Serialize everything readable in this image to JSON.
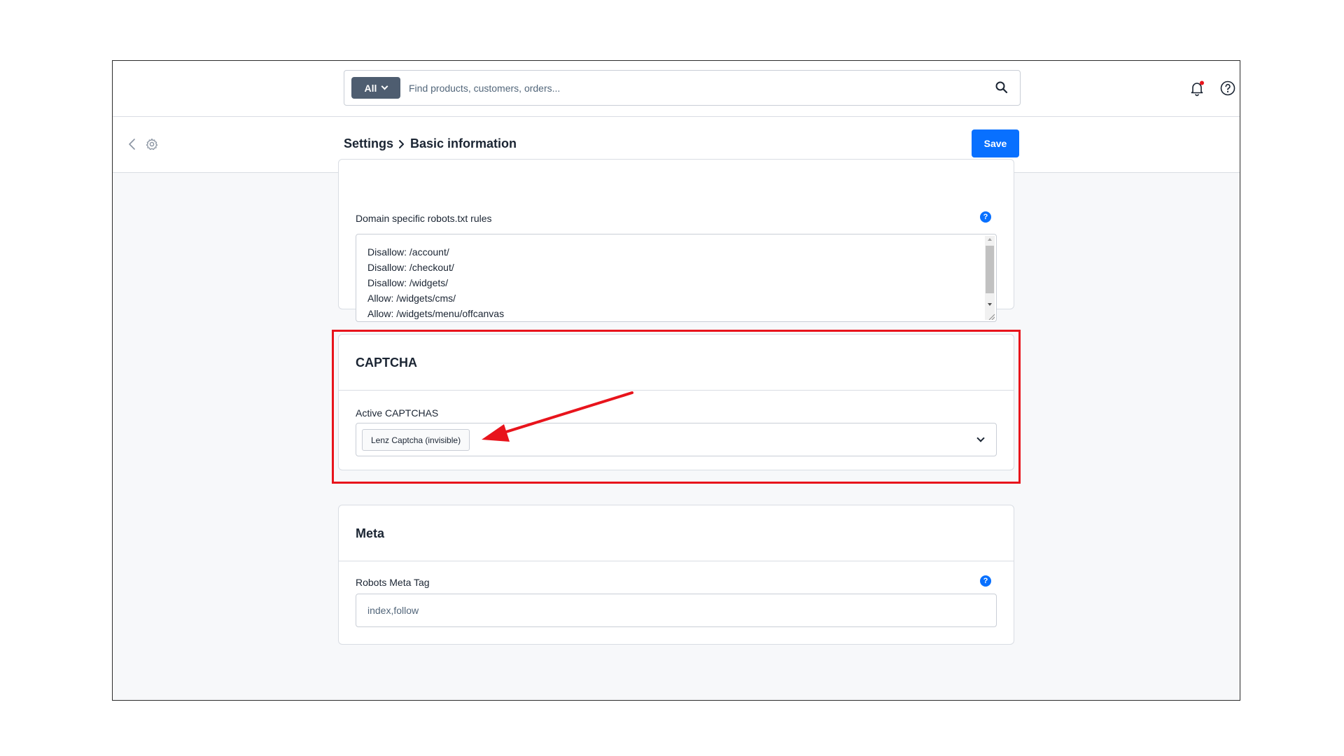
{
  "header": {
    "search_scope": "All",
    "search_placeholder": "Find products, customers, orders...",
    "has_notification": true
  },
  "subheader": {
    "breadcrumb": [
      "Settings",
      "Basic information"
    ],
    "save_label": "Save"
  },
  "robots": {
    "label": "Domain specific robots.txt rules",
    "lines": [
      "Disallow: /account/",
      "Disallow: /checkout/",
      "Disallow: /widgets/",
      "Allow: /widgets/cms/",
      "Allow: /widgets/menu/offcanvas"
    ]
  },
  "captcha": {
    "title": "CAPTCHA",
    "field_label": "Active CAPTCHAS",
    "selected_tags": [
      "Lenz Captcha (invisible)"
    ]
  },
  "meta": {
    "title": "Meta",
    "field_label": "Robots Meta Tag",
    "value": "index,follow"
  },
  "help_glyph": "?",
  "colors": {
    "primary": "#0870ff",
    "annotation": "#e8141c",
    "scope_bg": "#4e5d70"
  }
}
